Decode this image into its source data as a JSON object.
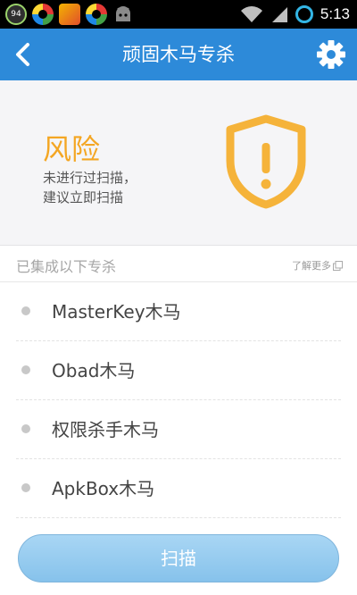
{
  "status_bar": {
    "time": "5:13",
    "badge_value": "94",
    "icons": [
      "battery-badge-icon",
      "browser-ring-icon",
      "apps-icon",
      "browser-ring-icon",
      "android-icon",
      "wifi-icon",
      "signal-icon",
      "sync-icon"
    ]
  },
  "header": {
    "title": "顽固木马专杀",
    "back_icon": "chevron-left-icon",
    "settings_icon": "gear-icon",
    "color": "#2d8ad9"
  },
  "risk": {
    "title": "风险",
    "description_line1": "未进行过扫描，",
    "description_line2": "建议立即扫描",
    "accent_color": "#f4a623",
    "icon": "warning-shield-icon"
  },
  "section": {
    "label": "已集成以下专杀",
    "more_link": "了解更多"
  },
  "items": [
    {
      "label": "MasterKey木马"
    },
    {
      "label": "Obad木马"
    },
    {
      "label": "权限杀手木马"
    },
    {
      "label": "ApkBox木马"
    }
  ],
  "scan_button": {
    "label": "扫描"
  }
}
